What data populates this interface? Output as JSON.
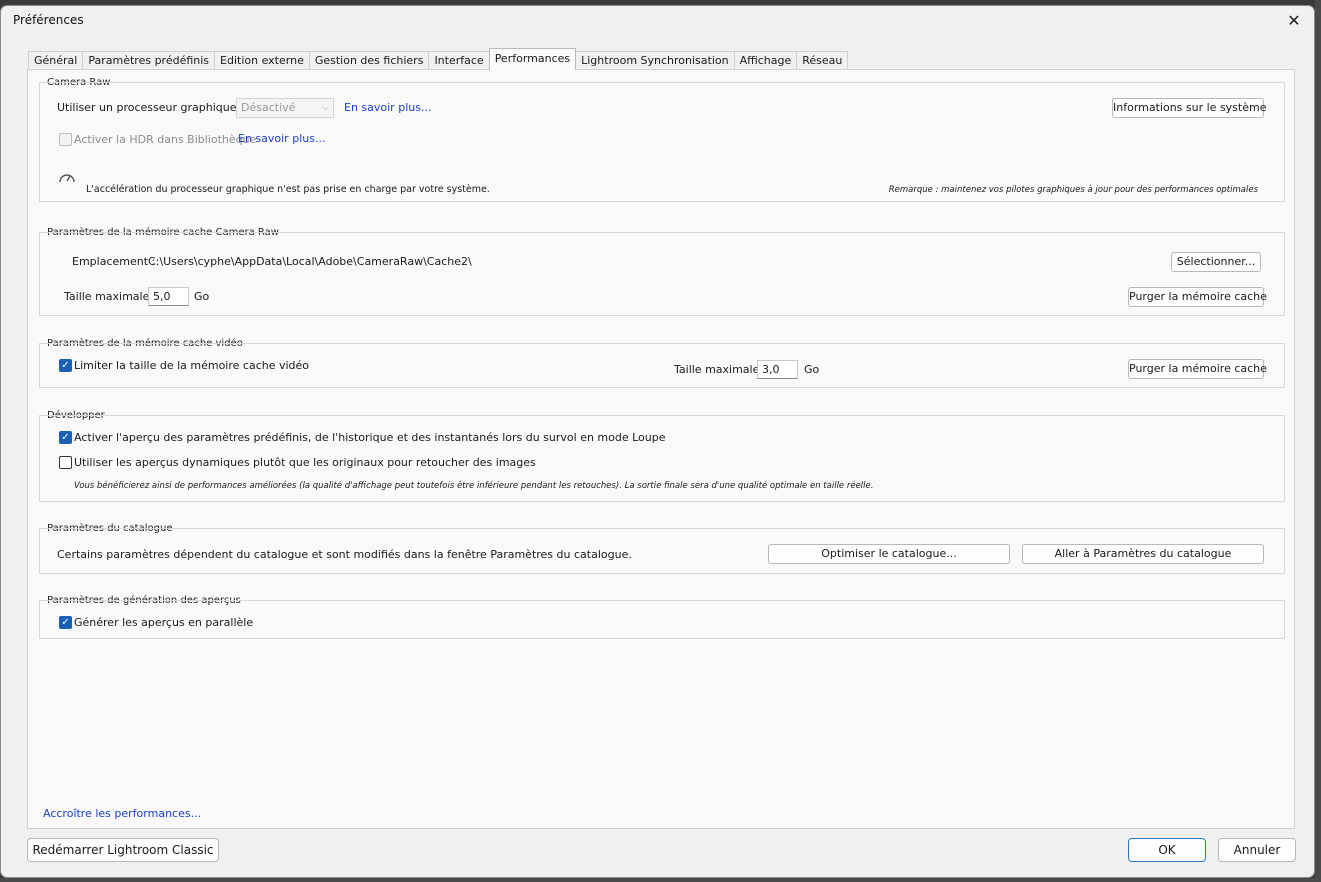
{
  "window": {
    "title": "Préférences",
    "close_glyph": "✕"
  },
  "tabs": [
    {
      "label": "Général"
    },
    {
      "label": "Paramètres prédéfinis"
    },
    {
      "label": "Edition externe"
    },
    {
      "label": "Gestion des fichiers"
    },
    {
      "label": "Interface"
    },
    {
      "label": "Performances",
      "active": true
    },
    {
      "label": "Lightroom Synchronisation"
    },
    {
      "label": "Affichage"
    },
    {
      "label": "Réseau"
    }
  ],
  "camera_raw": {
    "title": "Camera Raw",
    "gpu_label": "Utiliser un processeur graphique :",
    "gpu_value": "Désactivé",
    "learn_more_1": "En savoir plus...",
    "system_info_button": "Informations sur le système",
    "hdr_label": "Activer la HDR dans Bibliothèque",
    "hdr_checked": false,
    "learn_more_2": "En savoir plus...",
    "gpu_message": "L'accélération du processeur graphique n'est pas prise en charge par votre système.",
    "note": "Remarque : maintenez vos pilotes graphiques à jour pour des performances optimales"
  },
  "cache_raw": {
    "title": "Paramètres de la mémoire cache Camera Raw",
    "location_label": "Emplacement :",
    "location_value": "C:\\Users\\cyphe\\AppData\\Local\\Adobe\\CameraRaw\\Cache2\\",
    "select_button": "Sélectionner...",
    "max_label": "Taille maximale :",
    "max_value": "5,0",
    "unit": "Go",
    "purge_button": "Purger la mémoire cache"
  },
  "cache_video": {
    "title": "Paramètres de la mémoire cache vidéo",
    "limit_label": "Limiter la taille de la mémoire cache vidéo",
    "limit_checked": true,
    "max_label": "Taille maximale :",
    "max_value": "3,0",
    "unit": "Go",
    "purge_button": "Purger la mémoire cache"
  },
  "develop": {
    "title": "Développer",
    "preview_label": "Activer l'aperçu des paramètres prédéfinis, de l'historique et des instantanés lors du survol en mode Loupe",
    "preview_checked": true,
    "smart_label": "Utiliser les aperçus dynamiques plutôt que les originaux pour retoucher des images",
    "smart_checked": false,
    "smart_note": "Vous bénéficierez ainsi de performances améliorées (la qualité d'affichage peut toutefois être inférieure pendant les retouches). La sortie finale sera d'une qualité optimale en taille réelle."
  },
  "catalog": {
    "title": "Paramètres du catalogue",
    "text": "Certains paramètres dépendent du catalogue et sont modifiés dans la fenêtre Paramètres du catalogue.",
    "optimize_button": "Optimiser le catalogue...",
    "goto_button": "Aller à Paramètres du catalogue"
  },
  "previews": {
    "title": "Paramètres de génération des aperçus",
    "parallel_label": "Générer les aperçus en parallèle",
    "parallel_checked": true
  },
  "footer": {
    "more_link": "Accroître les performances...",
    "restart_button": "Redémarrer Lightroom Classic",
    "ok_button": "OK",
    "cancel_button": "Annuler"
  },
  "icons": {
    "gauge": "speedometer-icon",
    "check": "checkmark-icon",
    "chevron": "chevron-down-icon",
    "close": "close-icon"
  },
  "colors": {
    "link": "#1c3fc9",
    "checkbox": "#1a5fb4",
    "ok_border": "#2a74c9"
  }
}
